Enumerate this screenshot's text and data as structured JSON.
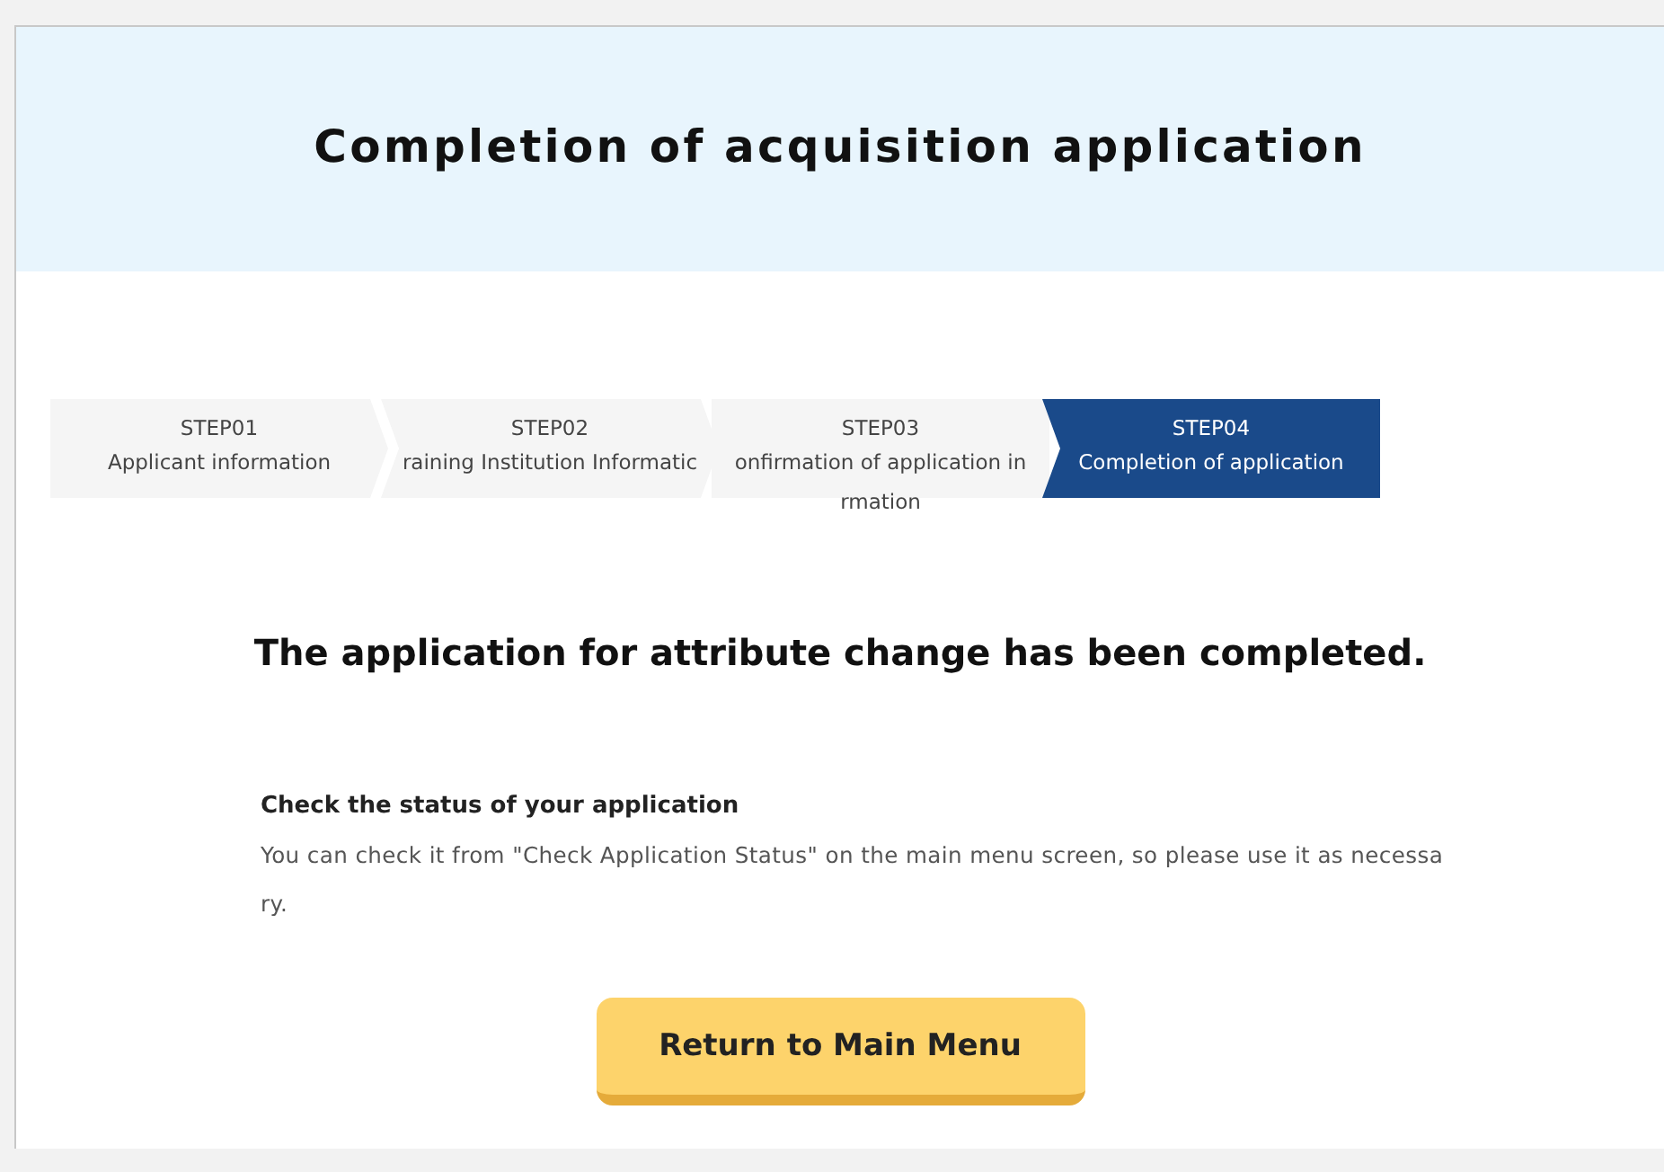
{
  "header": {
    "title": "Completion of acquisition application"
  },
  "steps": [
    {
      "number": "STEP01",
      "label_lines": [
        "Applicant information"
      ],
      "selected": false
    },
    {
      "number": "STEP02",
      "label_lines": [
        "raining Institution Informatic"
      ],
      "selected": false
    },
    {
      "number": "STEP03",
      "label_lines": [
        "onfirmation of application in",
        "rmation"
      ],
      "selected": false
    },
    {
      "number": "STEP04",
      "label_lines": [
        "Completion of application"
      ],
      "selected": true
    }
  ],
  "message": "The application for attribute change has been completed.",
  "status_section": {
    "heading": "Check the status of your application",
    "text_lines": [
      "You can check it from \"Check Application Status\" on the main menu screen, so please use it as necessa",
      "ry."
    ]
  },
  "button": "Return to Main Menu"
}
